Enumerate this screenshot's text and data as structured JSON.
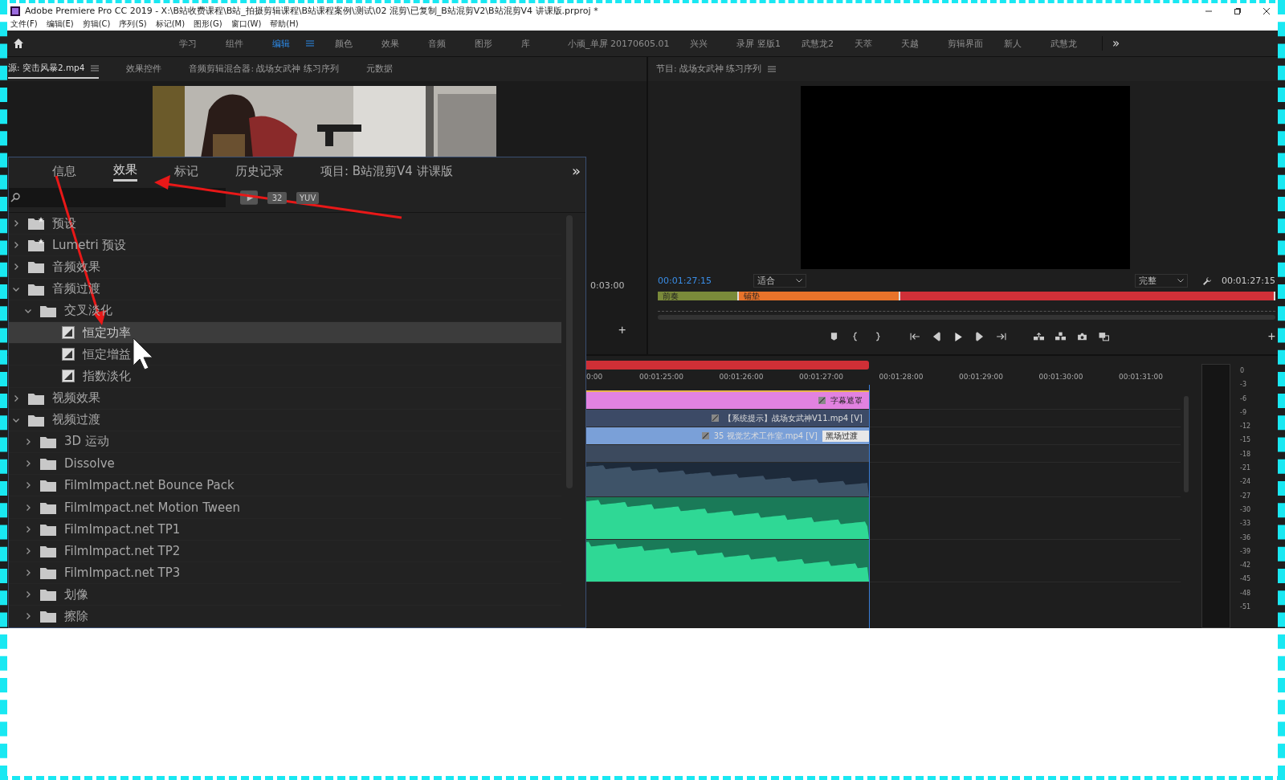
{
  "window": {
    "title": "Adobe Premiere Pro CC 2019 - X:\\B站收费课程\\B站_拍摄剪辑课程\\B站课程案例\\测试\\02 混剪\\已复制_B站混剪V2\\B站混剪V4 讲课版.prproj *"
  },
  "menu": [
    "文件(F)",
    "编辑(E)",
    "剪辑(C)",
    "序列(S)",
    "标记(M)",
    "图形(G)",
    "窗口(W)",
    "帮助(H)"
  ],
  "workspaces": [
    {
      "label": "学习",
      "selected": false
    },
    {
      "label": "组件",
      "selected": false
    },
    {
      "label": "编辑",
      "selected": true
    },
    {
      "label": "颜色",
      "selected": false
    },
    {
      "label": "效果",
      "selected": false
    },
    {
      "label": "音频",
      "selected": false
    },
    {
      "label": "图形",
      "selected": false
    },
    {
      "label": "库",
      "selected": false
    },
    {
      "label": "小顽_单屏 20170605.01",
      "selected": false
    },
    {
      "label": "兴兴",
      "selected": false
    },
    {
      "label": "录屏 竖版1",
      "selected": false
    },
    {
      "label": "武慧龙2",
      "selected": false
    },
    {
      "label": "天萃",
      "selected": false
    },
    {
      "label": "天越",
      "selected": false
    },
    {
      "label": "剪辑界面",
      "selected": false
    },
    {
      "label": "新人",
      "selected": false
    },
    {
      "label": "武慧龙",
      "selected": false
    }
  ],
  "workspace_overflow": "»",
  "source_panel": {
    "tabs": [
      {
        "label": "源: 突击风暴2.mp4",
        "selected": true
      },
      {
        "label": "效果控件",
        "selected": false
      },
      {
        "label": "音频剪辑混合器: 战场女武神 练习序列",
        "selected": false
      },
      {
        "label": "元数据",
        "selected": false
      }
    ],
    "timecode": "0:03:00",
    "add": "+"
  },
  "program_panel": {
    "title": "节目: 战场女武神 练习序列",
    "timecode": "00:01:27:15",
    "zoom": "适合",
    "quality": "完整",
    "duration": "00:01:27:15",
    "markers": [
      {
        "label": "前奏",
        "color": "#7a8a3a"
      },
      {
        "label": "铺垫",
        "color": "#e8732a"
      },
      {
        "color": "#d03038"
      }
    ],
    "add": "+"
  },
  "effects_panel": {
    "tabs": [
      {
        "label": "信息",
        "selected": false
      },
      {
        "label": "效果",
        "selected": true
      },
      {
        "label": "标记",
        "selected": false
      },
      {
        "label": "历史记录",
        "selected": false
      },
      {
        "label": "项目: B站混剪V4 讲课版",
        "selected": false
      }
    ],
    "overflow": "»",
    "filters": [
      "32",
      "YUV"
    ],
    "tree": [
      {
        "label": "预设",
        "kind": "star-folder",
        "expanded": false
      },
      {
        "label": "Lumetri 预设",
        "kind": "star-folder",
        "expanded": false
      },
      {
        "label": "音频效果",
        "kind": "folder",
        "expanded": false
      },
      {
        "label": "音频过渡",
        "kind": "folder",
        "expanded": true,
        "children": [
          {
            "label": "交叉淡化",
            "kind": "folder",
            "expanded": true,
            "children": [
              {
                "label": "恒定功率",
                "kind": "effect",
                "selected": true
              },
              {
                "label": "恒定增益",
                "kind": "effect",
                "selected": false
              },
              {
                "label": "指数淡化",
                "kind": "effect",
                "selected": false
              }
            ]
          }
        ]
      },
      {
        "label": "视频效果",
        "kind": "folder",
        "expanded": false
      },
      {
        "label": "视频过渡",
        "kind": "folder",
        "expanded": true,
        "children": [
          {
            "label": "3D 运动",
            "kind": "folder",
            "expanded": false
          },
          {
            "label": "Dissolve",
            "kind": "folder",
            "expanded": false
          },
          {
            "label": "FilmImpact.net Bounce Pack",
            "kind": "folder",
            "expanded": false
          },
          {
            "label": "FilmImpact.net Motion Tween",
            "kind": "folder",
            "expanded": false
          },
          {
            "label": "FilmImpact.net TP1",
            "kind": "folder",
            "expanded": false
          },
          {
            "label": "FilmImpact.net TP2",
            "kind": "folder",
            "expanded": false
          },
          {
            "label": "FilmImpact.net TP3",
            "kind": "folder",
            "expanded": false
          },
          {
            "label": "划像",
            "kind": "folder",
            "expanded": false
          },
          {
            "label": "擦除",
            "kind": "folder",
            "expanded": false
          }
        ]
      }
    ]
  },
  "timeline": {
    "ruler": [
      "0:00",
      "00:01:25:00",
      "00:01:26:00",
      "00:01:27:00",
      "00:01:28:00",
      "00:01:29:00",
      "00:01:30:00",
      "00:01:31:00"
    ],
    "clips": [
      {
        "label": "字幕遮罩",
        "kind": "graphic",
        "color": "#e282e0"
      },
      {
        "label": "【系统提示】战场女武神V11.mp4 [V]",
        "kind": "video",
        "color": "#3c4a66"
      },
      {
        "label": "35 视觉艺术工作室.mp4 [V]",
        "kind": "video",
        "color": "#7aa0d8",
        "transition": "黑场过渡"
      }
    ],
    "meter_scale": [
      "0",
      "-3",
      "-6",
      "-9",
      "-12",
      "-15",
      "-18",
      "-21",
      "-24",
      "-27",
      "-30",
      "-33",
      "-36",
      "-39",
      "-42",
      "-45",
      "-48",
      "-51"
    ]
  }
}
